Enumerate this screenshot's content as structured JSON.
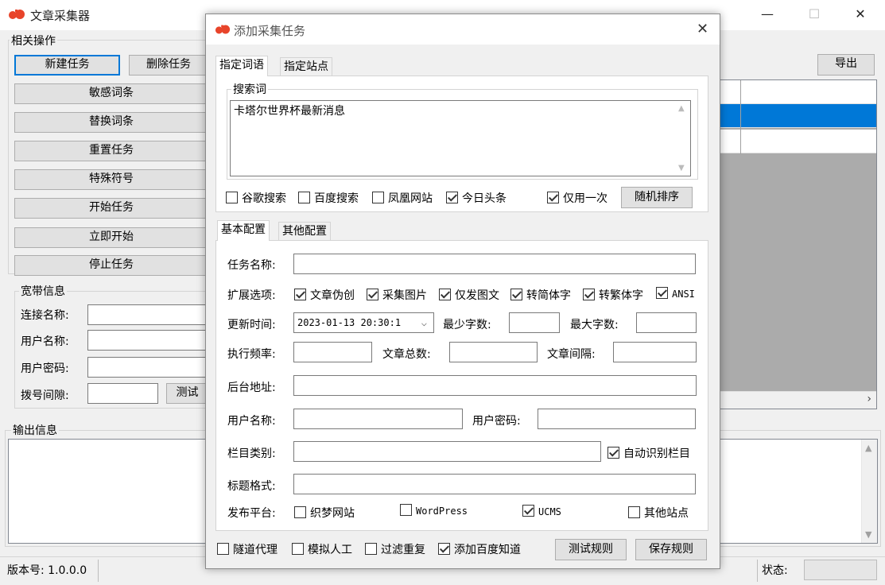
{
  "main": {
    "title": "文章采集器",
    "group_ops": "相关操作",
    "btn_new_task": "新建任务",
    "btn_delete_task": "删除任务",
    "btn_sensitive": "敏感词条",
    "btn_replace": "替换词条",
    "btn_reset": "重置任务",
    "btn_special": "特殊符号",
    "btn_start": "开始任务",
    "btn_start_now": "立即开始",
    "btn_stop": "停止任务",
    "btn_export": "导出",
    "group_broadband": "宽带信息",
    "conn_label": "连接名称:",
    "user_label": "用户名称:",
    "pwd_label": "用户密码:",
    "dial_label": "拨号间隙:",
    "btn_test": "测试",
    "group_output": "输出信息",
    "version": "版本号: 1.0.0.0",
    "status_label": "状态:"
  },
  "dialog": {
    "title": "添加采集任务",
    "tab_keywords": "指定词语",
    "tab_sites": "指定站点",
    "search_group": "搜索词",
    "search_text": "卡塔尔世界杯最新消息",
    "src_google": "谷歌搜索",
    "src_baidu": "百度搜索",
    "src_ifeng": "凤凰网站",
    "src_toutiao": "今日头条",
    "use_once": "仅用一次",
    "btn_random": "随机排序",
    "tab_basic": "基本配置",
    "tab_other": "其他配置",
    "task_name_label": "任务名称:",
    "ext_label": "扩展选项:",
    "opt_pseudo": "文章伪创",
    "opt_images": "采集图片",
    "opt_imgonly": "仅发图文",
    "opt_simp": "转简体字",
    "opt_trad": "转繁体字",
    "opt_ansi": "ANSI",
    "update_label": "更新时间:",
    "update_value": "2023-01-13 20:30:1",
    "min_words_label": "最少字数:",
    "max_words_label": "最大字数:",
    "freq_label": "执行频率:",
    "total_label": "文章总数:",
    "interval_label": "文章间隔:",
    "backend_label": "后台地址:",
    "user_label": "用户名称:",
    "pwd_label": "用户密码:",
    "category_label": "栏目类别:",
    "auto_cat": "自动识别栏目",
    "title_fmt_label": "标题格式:",
    "publish_label": "发布平台:",
    "plat_dede": "织梦网站",
    "plat_wp": "WordPress",
    "plat_ucms": "UCMS",
    "plat_other": "其他站点",
    "opt_proxy": "隧道代理",
    "opt_human": "模拟人工",
    "opt_dedup": "过滤重复",
    "opt_zhidao": "添加百度知道",
    "btn_test_rule": "测试规则",
    "btn_save_rule": "保存规则"
  }
}
